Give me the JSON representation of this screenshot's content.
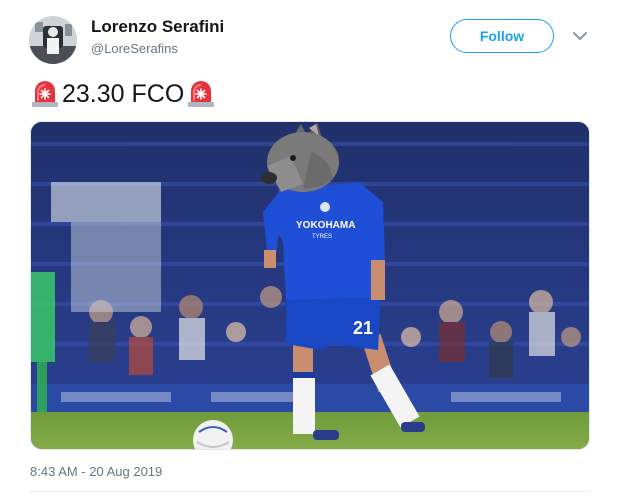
{
  "author": {
    "name": "Lorenzo Serafini",
    "handle": "@LoreSerafins"
  },
  "follow_button": {
    "label": "Follow"
  },
  "tweet": {
    "text": "23.30 FCO",
    "leading_emoji": "police-car-light-icon",
    "trailing_emoji": "police-car-light-icon"
  },
  "media": {
    "description_icon": "football-player-photo",
    "kit_sponsor": "YOKOHAMA",
    "kit_sponsor_sub": "TYRES",
    "shirt_number": "21"
  },
  "timestamp": "8:43 AM - 20 Aug 2019",
  "colors": {
    "accent": "#1da1f2",
    "secondary_text": "#657786",
    "siren_red": "#e5333b"
  }
}
